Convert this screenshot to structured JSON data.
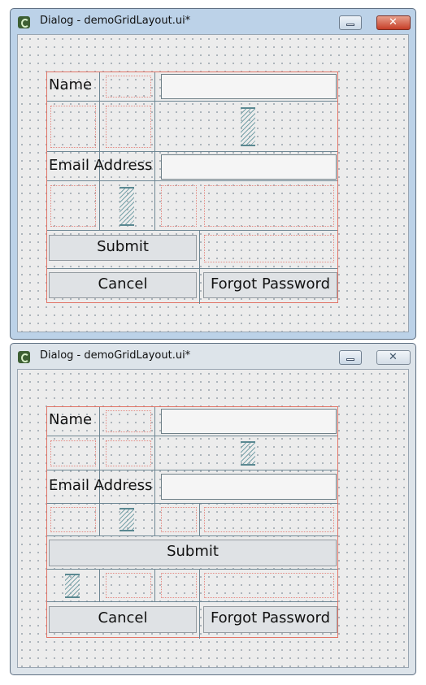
{
  "windows": [
    {
      "title": "Dialog - demoGridLayout.ui*",
      "name_label": "Name",
      "email_label": "Email Address",
      "submit_label": "Submit",
      "cancel_label": "Cancel",
      "forgot_label": "Forgot Password"
    },
    {
      "title": "Dialog - demoGridLayout.ui*",
      "name_label": "Name",
      "email_label": "Email Address",
      "submit_label": "Submit",
      "cancel_label": "Cancel",
      "forgot_label": "Forgot Password"
    }
  ],
  "icons": {
    "app": "qt-designer-icon",
    "minimize": "minimize-icon",
    "close": "close-icon",
    "spacer": "vertical-spacer-icon"
  },
  "colors": {
    "layout_border": "#e17467",
    "grid_lines": "#6e8794",
    "active_caption": "#bcd2e8",
    "inactive_caption": "#dde4ea",
    "close_active": "#c63e28"
  }
}
